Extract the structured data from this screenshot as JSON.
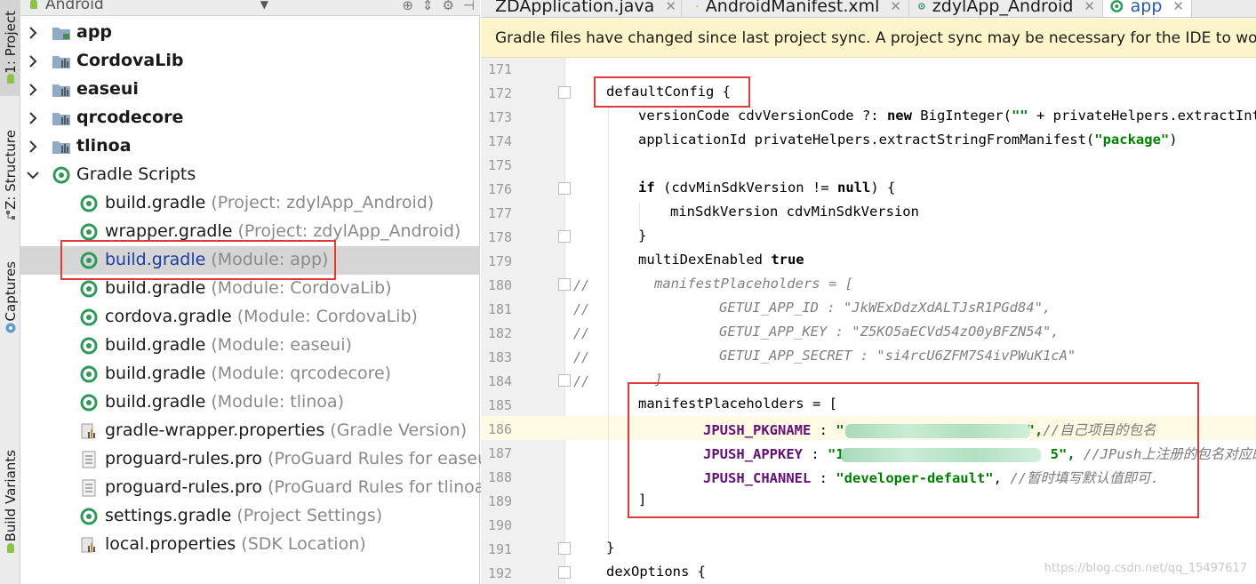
{
  "side_tabs": {
    "project": "1: Project",
    "structure": "Z: Structure",
    "captures": "Captures",
    "build_variants": "Build Variants"
  },
  "project_panel": {
    "view_mode": "Android",
    "tree": [
      {
        "label": "app",
        "hint": ""
      },
      {
        "label": "CordovaLib",
        "hint": ""
      },
      {
        "label": "easeui",
        "hint": ""
      },
      {
        "label": "qrcodecore",
        "hint": ""
      },
      {
        "label": "tlinoa",
        "hint": ""
      },
      {
        "label": "Gradle Scripts",
        "hint": ""
      },
      {
        "label": "build.gradle",
        "hint": "(Project: zdylApp_Android)"
      },
      {
        "label": "wrapper.gradle",
        "hint": "(Project: zdylApp_Android)"
      },
      {
        "label": "build.gradle",
        "hint": "(Module: app)"
      },
      {
        "label": "build.gradle",
        "hint": "(Module: CordovaLib)"
      },
      {
        "label": "cordova.gradle",
        "hint": "(Module: CordovaLib)"
      },
      {
        "label": "build.gradle",
        "hint": "(Module: easeui)"
      },
      {
        "label": "build.gradle",
        "hint": "(Module: qrcodecore)"
      },
      {
        "label": "build.gradle",
        "hint": "(Module: tlinoa)"
      },
      {
        "label": "gradle-wrapper.properties",
        "hint": "(Gradle Version)"
      },
      {
        "label": "proguard-rules.pro",
        "hint": "(ProGuard Rules for easeui)"
      },
      {
        "label": "proguard-rules.pro",
        "hint": "(ProGuard Rules for tlinoa)"
      },
      {
        "label": "settings.gradle",
        "hint": "(Project Settings)"
      },
      {
        "label": "local.properties",
        "hint": "(SDK Location)"
      }
    ]
  },
  "editor": {
    "tabs": [
      {
        "label": "ZDApplication.java"
      },
      {
        "label": "AndroidManifest.xml"
      },
      {
        "label": "zdylApp_Android"
      },
      {
        "label": "app"
      }
    ],
    "banner": "Gradle files have changed since last project sync. A project sync may be necessary for the IDE to work properly.",
    "line_numbers": [
      "171",
      "172",
      "173",
      "174",
      "175",
      "176",
      "177",
      "178",
      "179",
      "180",
      "181",
      "182",
      "183",
      "184",
      "185",
      "186",
      "187",
      "188",
      "189",
      "190",
      "191",
      "192"
    ],
    "code": {
      "l172": "defaultConfig {",
      "l173a": "versionCode cdvVersionCode ?: ",
      "l173b": "new",
      "l173c": " BigInteger(",
      "l173d": "\"\"",
      "l173e": " + privateHelpers.extractIntFromManifest(",
      "l174a": "applicationId privateHelpers.extractStringFromManifest(",
      "l174b": "\"package\"",
      "l174c": ")",
      "l176a": "if",
      "l176b": " (cdvMinSdkVersion != ",
      "l176c": "null",
      "l176d": ") {",
      "l177": "minSdkVersion cdvMinSdkVersion",
      "l178": "}",
      "l179a": "multiDexEnabled ",
      "l179b": "true",
      "l180": "manifestPlaceholders = [",
      "l181": "GETUI_APP_ID : \"JkWExDdzXdALTJsR1PGd84\",",
      "l182": "GETUI_APP_KEY : \"Z5KO5aECVd54zO0yBFZN54\",",
      "l183": "GETUI_APP_SECRET : \"si4rcU6ZFM7S4ivPWuK1cA\"",
      "l184": "]",
      "l185": "manifestPlaceholders = [",
      "l186a": "JPUSH_PKGNAME",
      "l186b": " : ",
      "l186c": "\"",
      "l186d": "\",",
      "l186e": "//自己项目的包名",
      "l187a": "JPUSH_APPKEY",
      "l187b": " : ",
      "l187c": "\"1",
      "l187d": "5\",",
      "l187e": " //JPush上注册的包名对应的Appkey.",
      "l188a": "JPUSH_CHANNEL",
      "l188b": " : ",
      "l188c": "\"developer-default\"",
      "l188d": ", ",
      "l188e": "//暂时填写默认值即可.",
      "l189": "]",
      "l191": "}",
      "l192": "dexOptions {"
    },
    "comment_marker": "//"
  },
  "watermark": "https://blog.csdn.net/qq_15497617"
}
